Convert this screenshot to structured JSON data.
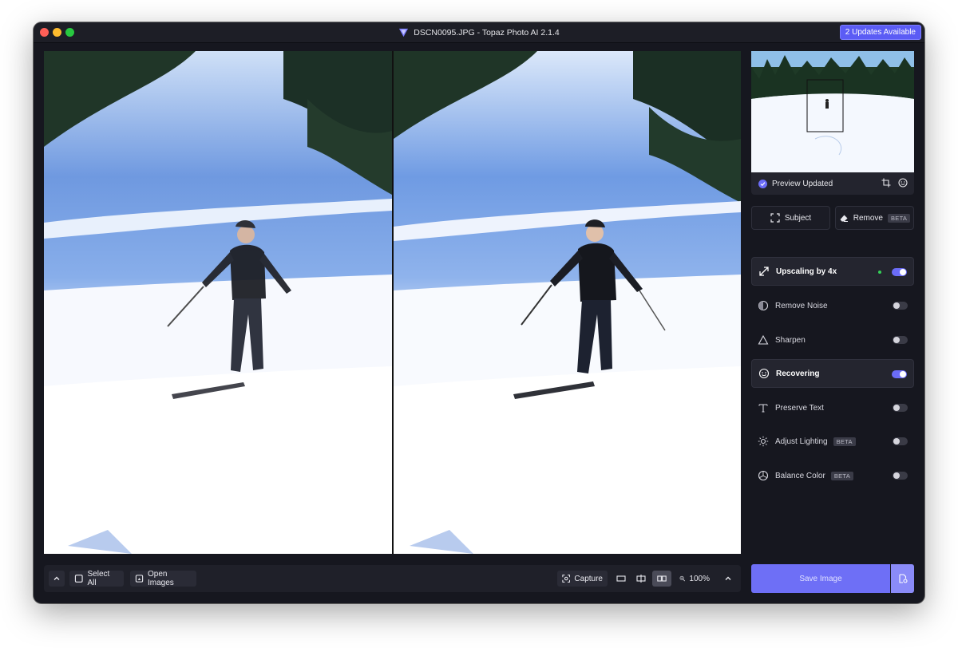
{
  "window": {
    "title": "DSCN0095.JPG - Topaz Photo AI 2.1.4",
    "updates_badge": "2 Updates Available",
    "accent_color": "#6b6cf7"
  },
  "panel": {
    "preview_status": "Preview Updated",
    "subject_label": "Subject",
    "remove_label": "Remove",
    "beta": "BETA",
    "upscaling_text": "Upscaling by",
    "upscaling_factor": "4x",
    "items": [
      {
        "label": "Remove Noise",
        "icon": "remove-noise-icon",
        "enabled": false
      },
      {
        "label": "Sharpen",
        "icon": "sharpen-icon",
        "enabled": false
      },
      {
        "label": "Recovering",
        "icon": "recover-face-icon",
        "enabled": true
      },
      {
        "label": "Preserve Text",
        "icon": "text-icon",
        "enabled": false
      },
      {
        "label": "Adjust Lighting",
        "icon": "sun-icon",
        "enabled": false,
        "beta": true
      },
      {
        "label": "Balance Color",
        "icon": "balance-color-icon",
        "enabled": false,
        "beta": true
      }
    ],
    "save_label": "Save Image"
  },
  "toolbar": {
    "select_all": "Select All",
    "open_images": "Open Images",
    "capture": "Capture",
    "zoom": "100%"
  }
}
